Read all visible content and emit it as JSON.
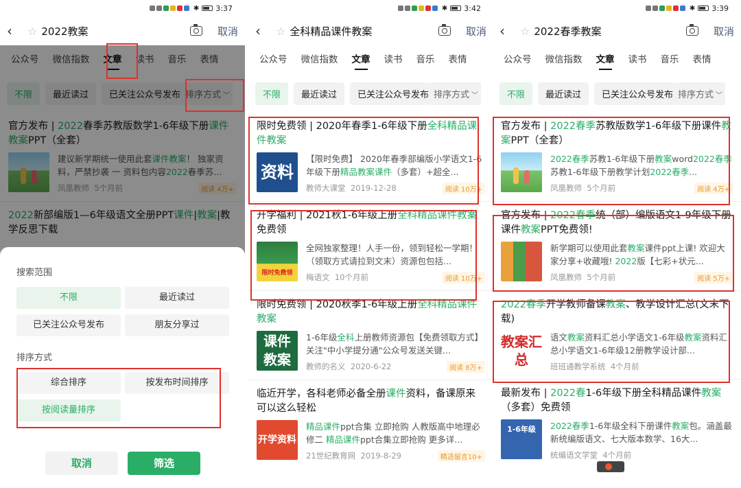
{
  "status_times": [
    "3:37",
    "3:42",
    "3:39"
  ],
  "common": {
    "cancel_label": "取消",
    "tabs": [
      "公众号",
      "微信指数",
      "文章",
      "读书",
      "音乐",
      "表情"
    ],
    "chips": [
      "不限",
      "最近读过",
      "已关注公众号发布"
    ],
    "sort_label": "排序方式"
  },
  "panel1": {
    "query": "2022教案",
    "results": [
      {
        "title": [
          {
            "t": "官方发布 | ",
            "hl": false
          },
          {
            "t": "2022",
            "hl": true
          },
          {
            "t": "春季苏教版数学1-6年级下册",
            "hl": false
          },
          {
            "t": "课件",
            "hl": true
          },
          {
            "t": "教案",
            "hl": true
          },
          {
            "t": "PPT（全套）",
            "hl": false
          }
        ],
        "desc": [
          {
            "t": "建议新学期统一使用此套",
            "hl": false
          },
          {
            "t": "课件",
            "hl": true
          },
          {
            "t": "教案",
            "hl": true
          },
          {
            "t": "！ 独家资料，严禁抄袭 一 资料包内容",
            "hl": false
          },
          {
            "t": "2022",
            "hl": true
          },
          {
            "t": "春季苏...",
            "hl": false
          }
        ],
        "source": "凤凰教师",
        "time": "5个月前",
        "reads": "阅读 4万+"
      },
      {
        "title": [
          {
            "t": "2022",
            "hl": true
          },
          {
            "t": "新部编版1—6年级语文全册PPT",
            "hl": false
          },
          {
            "t": "课件",
            "hl": true
          },
          {
            "t": "|",
            "hl": false
          },
          {
            "t": "教案",
            "hl": true
          },
          {
            "t": "|教学反思下载",
            "hl": false
          }
        ]
      }
    ],
    "sheet": {
      "scope_heading": "搜索范围",
      "scope_options": [
        "不限",
        "最近读过",
        "已关注公众号发布",
        "朋友分享过"
      ],
      "sort_heading": "排序方式",
      "sort_options": [
        "综合排序",
        "按发布时间排序",
        "按阅读量排序"
      ],
      "cancel": "取消",
      "confirm": "筛选"
    }
  },
  "panel2": {
    "query": "全科精品课件教案",
    "results": [
      {
        "title": [
          {
            "t": "限时免费领 | 2020年春季1-6年级下册",
            "hl": false
          },
          {
            "t": "全科精品课件教案",
            "hl": true
          }
        ],
        "desc": [
          {
            "t": "【限时免费】 2020年春季部编版小学语文1-6年级下册",
            "hl": false
          },
          {
            "t": "精品教案课件",
            "hl": true
          },
          {
            "t": "（多套）+超全...",
            "hl": false
          }
        ],
        "thumb_text": "资料",
        "source": "教师大课堂",
        "time": "2019-12-28",
        "reads": "阅读 10万+"
      },
      {
        "title": [
          {
            "t": "开学福利 | 2021秋1-6年级上册",
            "hl": false
          },
          {
            "t": "全科精品课件教案",
            "hl": true
          },
          {
            "t": "免费领",
            "hl": false
          }
        ],
        "desc": [
          {
            "t": "全网独家整理！人手一份，领到轻松一学期！（领取方式请拉到文末）资源包包括...",
            "hl": false
          }
        ],
        "thumb_text": "限时免费领",
        "source": "梅语文",
        "time": "10个月前",
        "reads": "阅读 10万+"
      },
      {
        "title": [
          {
            "t": "限时免费领 | 2020秋季1-6年级上册",
            "hl": false
          },
          {
            "t": "全科精品课件教案",
            "hl": true
          }
        ],
        "desc": [
          {
            "t": "1-6年级",
            "hl": false
          },
          {
            "t": "全科",
            "hl": true
          },
          {
            "t": "上册教师资源包【免费领取方式】关注\"中小学提分通\"公众号发送关键...",
            "hl": false
          }
        ],
        "thumb_text": "课件教案",
        "source": "教师的名义",
        "time": "2020-6-22",
        "reads": "阅读 8万+"
      },
      {
        "title": [
          {
            "t": "临近开学，各科老师必备全册",
            "hl": false
          },
          {
            "t": "课件",
            "hl": true
          },
          {
            "t": "资料，备课原来可以这么轻松",
            "hl": false
          }
        ],
        "desc": [
          {
            "t": "精品课件",
            "hl": true
          },
          {
            "t": "ppt合集 立即抢购 人教版高中地理必修二 ",
            "hl": false
          },
          {
            "t": "精品课件",
            "hl": true
          },
          {
            "t": "ppt合集立即抢购 更多详...",
            "hl": false
          }
        ],
        "thumb_text": "开学资料",
        "source": "21世纪教育网",
        "time": "2019-8-29",
        "reads": "精选留言10+"
      }
    ]
  },
  "panel3": {
    "query": "2022春季教案",
    "results": [
      {
        "title": [
          {
            "t": "官方发布 | ",
            "hl": false
          },
          {
            "t": "2022春季",
            "hl": true
          },
          {
            "t": "苏教版数学1-6年级下册课件",
            "hl": false
          },
          {
            "t": "教案",
            "hl": true
          },
          {
            "t": "PPT（全套）",
            "hl": false
          }
        ],
        "desc": [
          {
            "t": "2022春季",
            "hl": true
          },
          {
            "t": "苏教1-6年级下册",
            "hl": false
          },
          {
            "t": "教案",
            "hl": true
          },
          {
            "t": "word",
            "hl": false
          },
          {
            "t": "2022春季",
            "hl": true
          },
          {
            "t": "苏教1-6年级下册教学计划",
            "hl": false
          },
          {
            "t": "2022春季",
            "hl": true
          },
          {
            "t": "...",
            "hl": false
          }
        ],
        "source": "凤凰教师",
        "time": "5个月前",
        "reads": "阅读 4万+"
      },
      {
        "title": [
          {
            "t": "官方发布 | ",
            "hl": false
          },
          {
            "t": "2022春季",
            "hl": true
          },
          {
            "t": "统（部）编版语文1-9年级下册课件",
            "hl": false
          },
          {
            "t": "教案",
            "hl": true
          },
          {
            "t": "PPT免费领!",
            "hl": false
          }
        ],
        "desc": [
          {
            "t": "新学期可以使用此套",
            "hl": false
          },
          {
            "t": "教案",
            "hl": true
          },
          {
            "t": "课件ppt上课! 欢迎大家分享+收藏哦! ",
            "hl": false
          },
          {
            "t": "2022",
            "hl": true
          },
          {
            "t": "版【七彩+状元...",
            "hl": false
          }
        ],
        "source": "凤凰教师",
        "time": "5个月前",
        "reads": "阅读 5万+"
      },
      {
        "title": [
          {
            "t": "2022春季",
            "hl": true
          },
          {
            "t": "开学教师备课",
            "hl": false
          },
          {
            "t": "教案",
            "hl": true
          },
          {
            "t": "、教学设计汇总(文末下载)",
            "hl": false
          }
        ],
        "desc": [
          {
            "t": "语文",
            "hl": false
          },
          {
            "t": "教案",
            "hl": true
          },
          {
            "t": "资料汇总小学语文1-6年级",
            "hl": false
          },
          {
            "t": "教案",
            "hl": true
          },
          {
            "t": "资料汇总小学语文1-6年级12册教学设计部...",
            "hl": false
          }
        ],
        "thumb_text": "教案汇总",
        "source": "班班通教学系统",
        "time": "4个月前"
      },
      {
        "title": [
          {
            "t": "最新发布 | ",
            "hl": false
          },
          {
            "t": "2022春",
            "hl": true
          },
          {
            "t": "1-6年级下册全科精品课件",
            "hl": false
          },
          {
            "t": "教案",
            "hl": true
          },
          {
            "t": "（多套）免费领",
            "hl": false
          }
        ],
        "desc": [
          {
            "t": "2022春季",
            "hl": true
          },
          {
            "t": "1-6年级全科下册课件",
            "hl": false
          },
          {
            "t": "教案",
            "hl": true
          },
          {
            "t": "包。涵盖最新统编版语文、七大版本数学、16大...",
            "hl": false
          }
        ],
        "thumb_text": "1-6年级",
        "source": "统编语文学堂",
        "time": "4个月前"
      }
    ]
  },
  "colors": {
    "highlight": "#2aae67",
    "annotation_box": "#e0302a",
    "read_badge": "#e89a2d"
  }
}
